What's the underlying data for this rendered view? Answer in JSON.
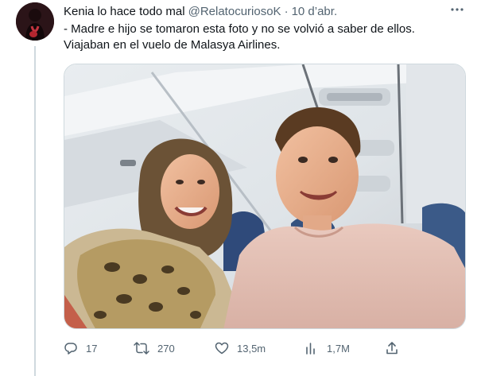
{
  "tweet": {
    "author_name": "Kenia lo hace todo mal",
    "author_handle": "@RelatocuriosoK",
    "separator": "·",
    "date": "10 d’abr.",
    "text_line1": "- Madre e hijo se tomaron esta foto y no se volvió a saber de ellos.",
    "text_line2": "Viajaban en el vuelo de Malasya Airlines."
  },
  "actions": {
    "replies": "17",
    "retweets": "270",
    "likes": "13,5m",
    "views": "1,7M"
  },
  "icons": {
    "more": "more-horizontal-icon",
    "reply": "reply-icon",
    "retweet": "retweet-icon",
    "like": "heart-icon",
    "views": "analytics-icon",
    "share": "share-icon"
  },
  "colors": {
    "secondary_text": "#536471",
    "primary_text": "#0f1419",
    "thread_line": "#cfd9de"
  }
}
